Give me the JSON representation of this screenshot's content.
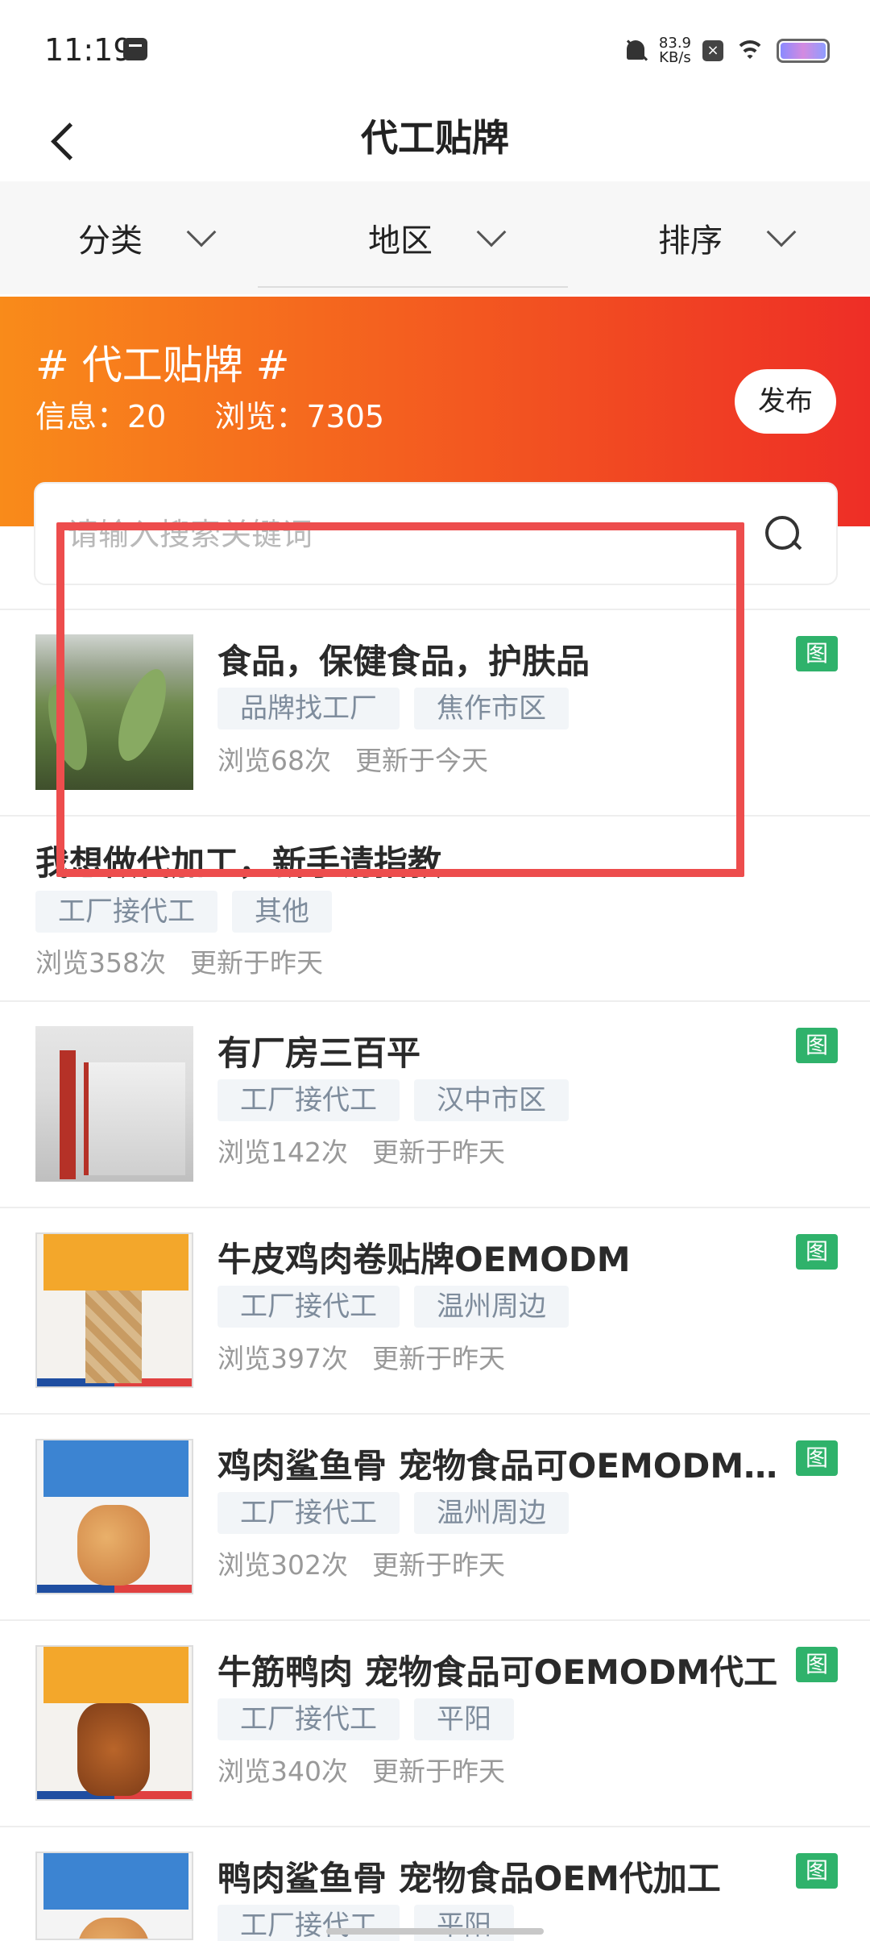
{
  "status_bar": {
    "time": "11:19",
    "net_speed_value": "83.9",
    "net_speed_unit": "KB/s",
    "icons": [
      "message-icon",
      "bell-muted-icon",
      "close-box-icon",
      "wifi-icon",
      "battery-icon"
    ]
  },
  "nav": {
    "title": "代工贴牌"
  },
  "filters": [
    {
      "label": "分类"
    },
    {
      "label": "地区"
    },
    {
      "label": "排序"
    }
  ],
  "banner": {
    "title": "# 代工贴牌 #",
    "info_label": "信息：20",
    "views_label": "浏览：7305",
    "publish_label": "发布",
    "colors": {
      "start": "#f98b1a",
      "end": "#ee2e26"
    }
  },
  "search": {
    "placeholder": "请输入搜索关键词"
  },
  "items": [
    {
      "title": "食品，保健食品，护肤品",
      "tags": [
        "品牌找工厂",
        "焦作市区"
      ],
      "views": "浏览68次",
      "updated": "更新于今天",
      "badge": "图"
    },
    {
      "title": "我想做代加工，新手请指教",
      "tags": [
        "工厂接代工",
        "其他"
      ],
      "views": "浏览358次",
      "updated": "更新于昨天"
    },
    {
      "title": "有厂房三百平",
      "tags": [
        "工厂接代工",
        "汉中市区"
      ],
      "views": "浏览142次",
      "updated": "更新于昨天",
      "badge": "图"
    },
    {
      "title": "牛皮鸡肉卷贴牌OEMODM",
      "tags": [
        "工厂接代工",
        "温州周边"
      ],
      "views": "浏览397次",
      "updated": "更新于昨天",
      "badge": "图"
    },
    {
      "title": "鸡肉鲨鱼骨 宠物食品可OEMODM…",
      "tags": [
        "工厂接代工",
        "温州周边"
      ],
      "views": "浏览302次",
      "updated": "更新于昨天",
      "badge": "图"
    },
    {
      "title": "牛筋鸭肉 宠物食品可OEMODM代工",
      "tags": [
        "工厂接代工",
        "平阳"
      ],
      "views": "浏览340次",
      "updated": "更新于昨天",
      "badge": "图"
    },
    {
      "title": "鸭肉鲨鱼骨 宠物食品OEM代加工",
      "tags": [
        "工厂接代工",
        "平阳"
      ],
      "badge": "图"
    }
  ],
  "colors": {
    "badge_green": "#2fb26b",
    "highlight_red": "#ed4d4d",
    "tag_bg": "#f2f5f8",
    "tag_text": "#7e8c9c"
  }
}
